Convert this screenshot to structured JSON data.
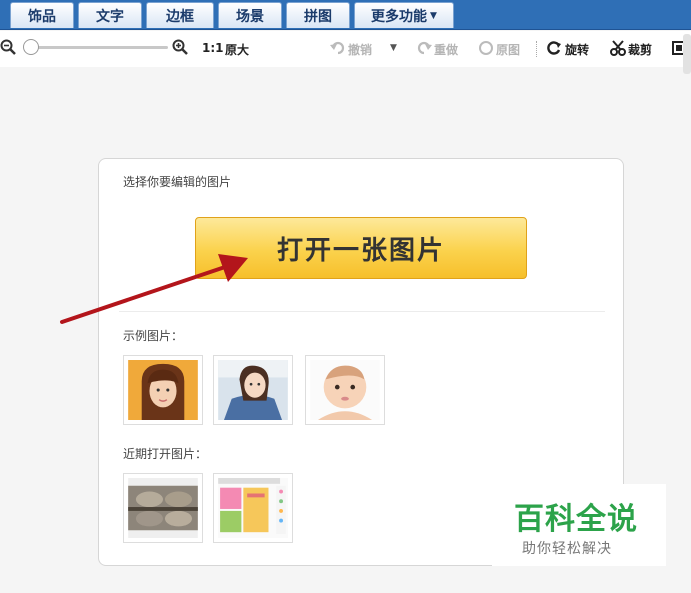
{
  "tabs": [
    {
      "label": "饰品"
    },
    {
      "label": "文字"
    },
    {
      "label": "边框"
    },
    {
      "label": "场景"
    },
    {
      "label": "拼图"
    },
    {
      "label": "更多功能"
    }
  ],
  "toolbar": {
    "ratio_label": "1:1",
    "actual_size_label": "原大",
    "undo_label": "撤销",
    "redo_label": "重做",
    "original_label": "原图",
    "rotate_label": "旋转",
    "crop_label": "裁剪"
  },
  "card": {
    "select_label": "选择你要编辑的图片",
    "open_button_label": "打开一张图片",
    "sample_label": "示例图片：",
    "recent_label": "近期打开图片："
  },
  "watermark": {
    "title": "百科全说",
    "subtitle": "助你轻松解决"
  },
  "colors": {
    "tabbar": "#2f6fb6",
    "button": "#fbd24c",
    "arrow": "#b3151b",
    "watermark": "#2ca34a"
  }
}
